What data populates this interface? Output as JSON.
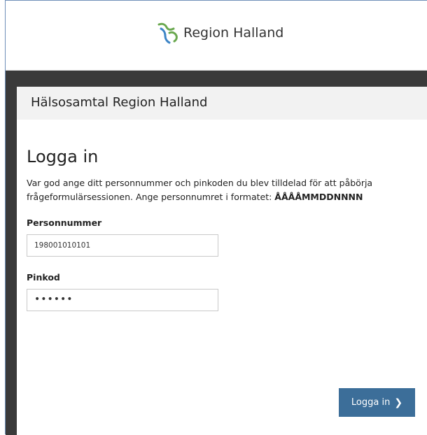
{
  "header": {
    "logo_text": "Region Halland",
    "logo_icon": "region-halland-logo-icon"
  },
  "page": {
    "subheader_title": "Hälsosamtal Region Halland",
    "login_title": "Logga in",
    "instructions_prefix": "Var god ange ditt personnummer och pinkoden du blev tilldelad för att påbörja frågeformulärsessionen. Ange personnumret i formatet: ",
    "instructions_format": "ÅÅÅÅMMDDNNNN"
  },
  "form": {
    "personnummer_label": "Personnummer",
    "personnummer_value": "198001010101",
    "pinkod_label": "Pinkod",
    "pinkod_value": "••••••",
    "submit_label": "Logga in",
    "submit_icon": "chevron-right-icon"
  },
  "colors": {
    "button": "#3c6e99",
    "dark_bar": "#3a3a3a",
    "subheader_bg": "#f2f2f2",
    "logo_green": "#6aa84f",
    "logo_blue": "#3d85c6"
  }
}
